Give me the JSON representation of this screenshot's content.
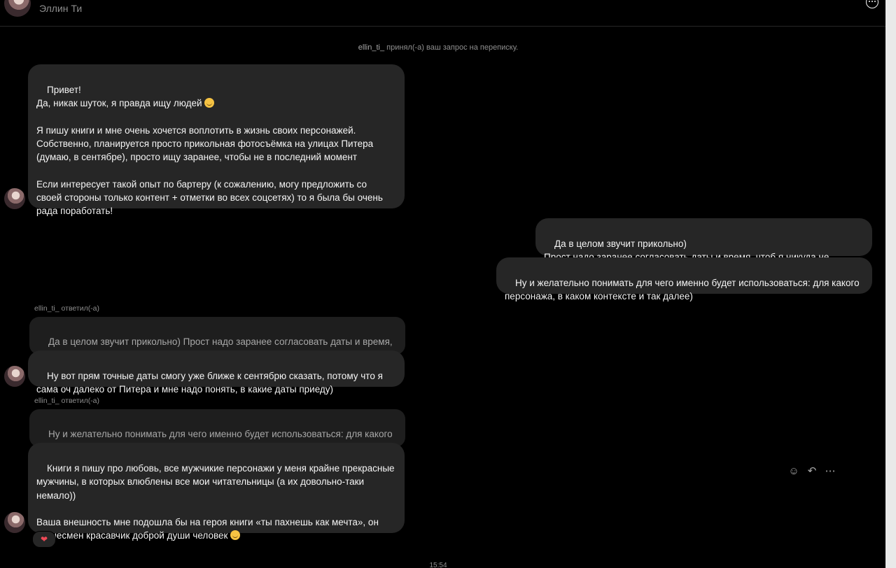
{
  "header": {
    "contact_name": "Эллин Ти"
  },
  "system": {
    "username": "ellin_ti_",
    "text": " принял(-а) ваш запрос на переписку."
  },
  "messages": {
    "m1": "Привет!\nДа, никак шуток, я правда ищу людей ",
    "m1b": "\n\nЯ пишу книги и мне очень хочется воплотить в жизнь своих персонажей.\nСобственно, планируется просто прикольная фотосъёмка на улицах Питера\n(думаю, в сентябре), просто ищу заранее, чтобы не в последний момент\n\nЕсли интересует такой опыт по бартеру (к сожалению, могу предложить со\nсвоей стороны только контент + отметки во всех соцсетях) то я была бы очень\nрада поработать!",
    "out1": "Да в целом звучит прикольно)\nПрост надо заранее согласовать даты и время, чтоб я никуда не улетел))",
    "out2": "Ну и желательно понимать для чего именно будет использоваться: для какого\nперсонажа, в каком контексте и так далее)",
    "reply1_label": "ellin_ti_ ответил(-а)",
    "reply1_quote": "Да в целом звучит прикольно) Прост надо заранее согласовать даты и время,\nчтоб я никуда не улетел))",
    "reply1_text": "Ну вот прям точные даты смогу уже ближе к сентябрю сказать, потому что я\nсама оч далеко от Питера и мне надо понять, в какие даты приеду)",
    "reply2_label": "ellin_ti_ ответил(-а)",
    "reply2_quote": "Ну и желательно понимать для чего именно будет использоваться: для какого\nперсонажа, в каком контексте и так далее)",
    "reply2_text": "Книги я пишу про любовь, все мужчикие персонажи у меня крайне прекрасные\nмужчины, в которых влюблены все мои читательницы (а их довольно-таки\nнемало))\n\nВаша внешность мне подошла бы на героя книги «ты пахнешь как мечта», он\nбизнесмен красавчик доброй души человек "
  },
  "reaction": "❤",
  "timestamp": "15:54",
  "colors": {
    "background": "#000000",
    "bubble": "#262626",
    "muted_text": "#8e8e8e"
  },
  "icons": {
    "emoji_react": "smile-icon",
    "reply": "reply-icon",
    "more": "more-icon"
  }
}
